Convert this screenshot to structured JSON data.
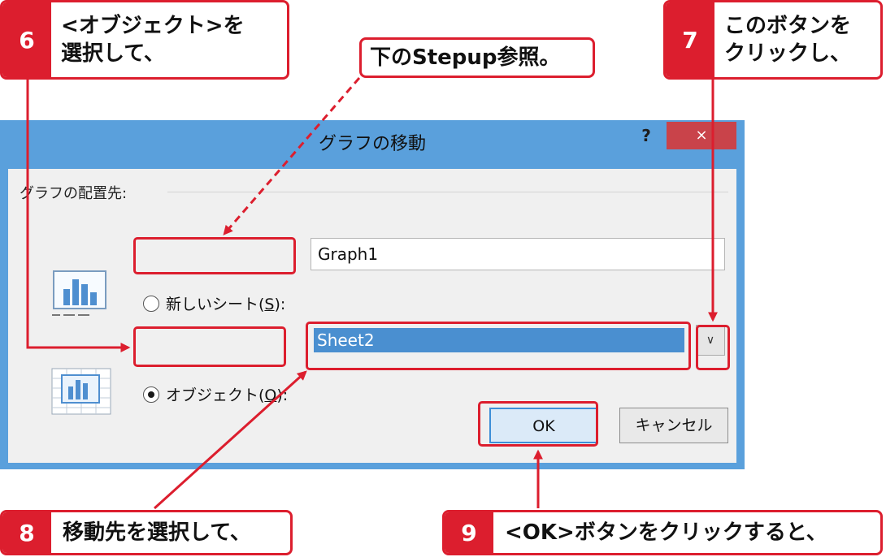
{
  "dialog": {
    "title": "グラフの移動",
    "help": "?",
    "close": "×",
    "group_label": "グラフの配置先:",
    "option_new_sheet": {
      "label": "新しいシート(",
      "mnemonic": "S",
      "suffix": "):",
      "value": "Graph1",
      "selected": false
    },
    "option_object": {
      "label": "オブジェクト(",
      "mnemonic": "O",
      "suffix": "):",
      "value": "Sheet2",
      "selected": true
    },
    "dropdown_icon": "chevron-down-icon",
    "ok_label": "OK",
    "cancel_label": "キャンセル"
  },
  "callouts": {
    "step6": {
      "num": "6",
      "text_line1": "<オブジェクト>を",
      "text_line2": "選択して、"
    },
    "note": {
      "text": "下のStepup参照。"
    },
    "step7": {
      "num": "7",
      "text_line1": "このボタンを",
      "text_line2": "クリックし、"
    },
    "step8": {
      "num": "8",
      "text": "移動先を選択して、"
    },
    "step9": {
      "num": "9",
      "text": "<OK>ボタンをクリックすると、"
    }
  },
  "colors": {
    "accent_red": "#dc1e2e",
    "title_bar": "#5aa0dc",
    "selection": "#4a8fd0",
    "close_button": "#c9434a"
  }
}
